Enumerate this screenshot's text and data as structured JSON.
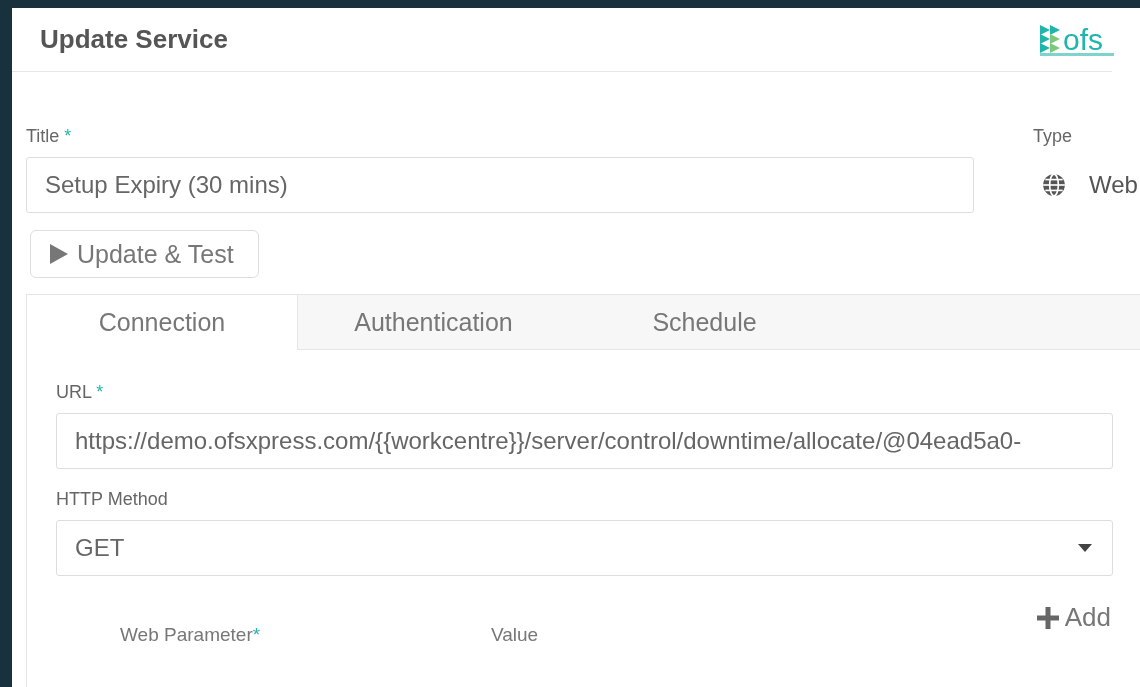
{
  "header": {
    "title": "Update Service",
    "logo": {
      "name": "ofs"
    }
  },
  "title_field": {
    "label": "Title",
    "mark": "*",
    "value": "Setup Expiry (30 mins)"
  },
  "type_field": {
    "label": "Type",
    "value": "Web"
  },
  "test_button": {
    "label": "Update & Test"
  },
  "tabs": [
    {
      "label": "Connection",
      "selected": true
    },
    {
      "label": "Authentication",
      "selected": false
    },
    {
      "label": "Schedule",
      "selected": false
    }
  ],
  "url_field": {
    "label": "URL",
    "mark": "*",
    "value": "https://demo.ofsxpress.com/{{workcentre}}/server/control/downtime/allocate/@04ead5a0-"
  },
  "method_field": {
    "label": "HTTP Method",
    "value": "GET"
  },
  "add_button": {
    "label": "Add"
  },
  "parameters": {
    "columns": [
      {
        "label": "Web Parameter",
        "mark": "*"
      },
      {
        "label": "Value"
      }
    ]
  }
}
